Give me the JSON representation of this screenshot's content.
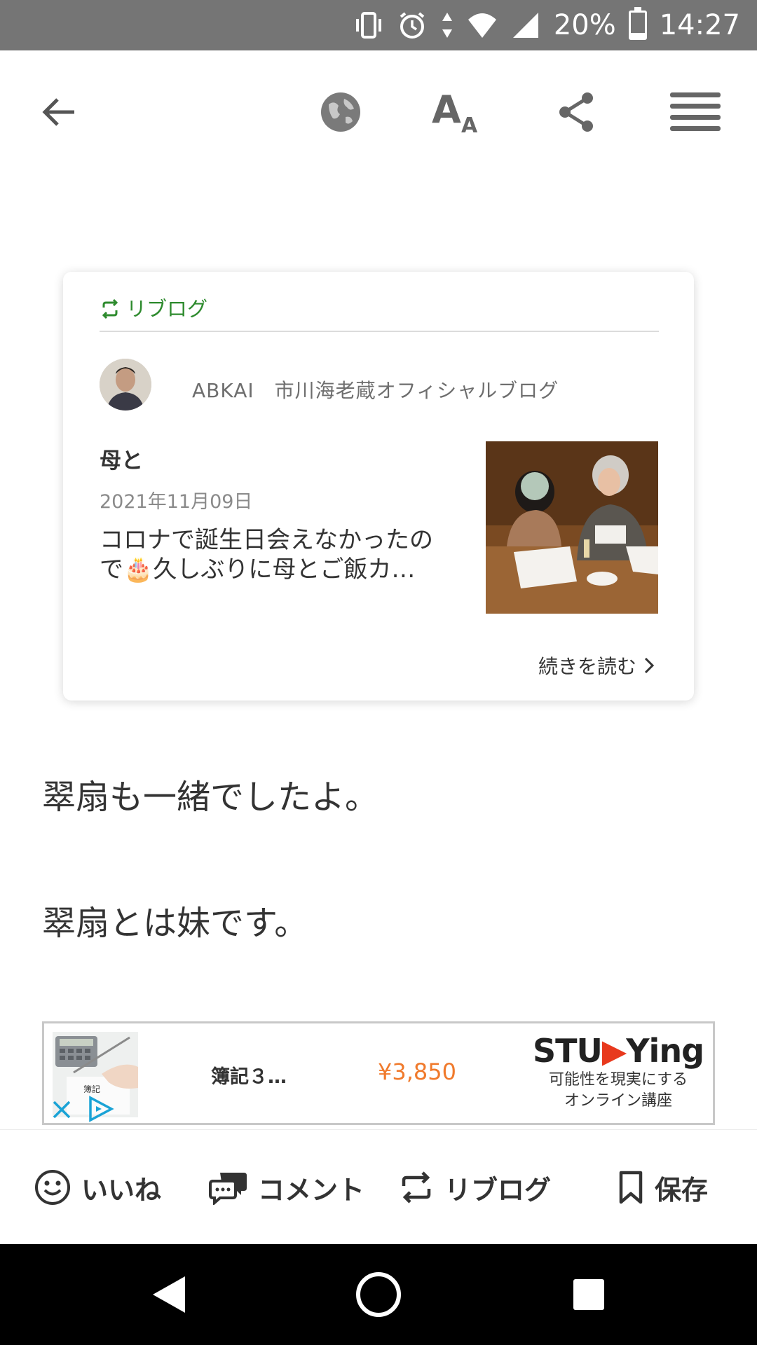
{
  "status_bar": {
    "battery": "20%",
    "time": "14:27",
    "icons": [
      "vibrate-icon",
      "alarm-icon",
      "data-icon",
      "wifi-icon",
      "signal-icon",
      "battery-icon"
    ]
  },
  "toolbar": {
    "icons": [
      "back-arrow-icon",
      "globe-icon",
      "font-size-icon",
      "share-icon",
      "menu-icon"
    ]
  },
  "reblog_card": {
    "label": "リブログ",
    "blog_name": "ABKAI　市川海老蔵オフィシャルブログ",
    "title": "母と",
    "date": "2021年11月09日",
    "excerpt_line1": "コロナで誕生日会えなかったの",
    "excerpt_line2_pre": "で",
    "excerpt_emoji": "🎂",
    "excerpt_line2_post": "久しぶりに母とご飯カ…",
    "read_more": "続きを読む"
  },
  "body": {
    "paragraph1": "翠扇も一緒でしたよ。",
    "paragraph2": "翠扇とは妹です。"
  },
  "ad": {
    "title": "簿記３…",
    "price": "¥3,850",
    "brand_pre": "STU",
    "brand_post": "Ying",
    "tagline1": "可能性を現実にする",
    "tagline2": "オンライン講座",
    "image_text": "簿記"
  },
  "action_bar": {
    "like": "いいね",
    "comment": "コメント",
    "reblog": "リブログ",
    "save": "保存"
  },
  "colors": {
    "accent_green": "#2e8b2e",
    "price_orange": "#f07a2c",
    "status_bar": "#757575"
  }
}
